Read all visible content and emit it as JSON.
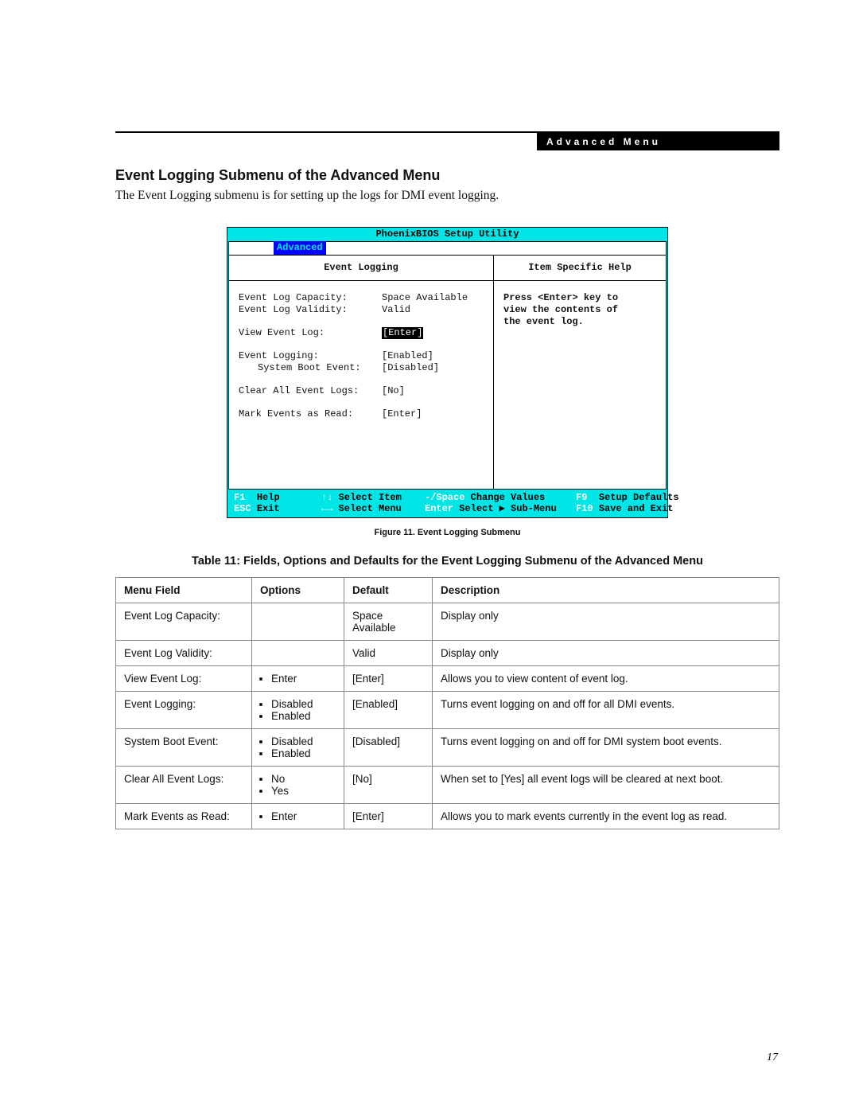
{
  "header": {
    "tab_label": "Advanced Menu"
  },
  "section": {
    "title": "Event Logging Submenu of the Advanced Menu",
    "intro": "The Event Logging submenu is for setting up the logs for DMI event logging."
  },
  "bios": {
    "utility_title": "PhoenixBIOS Setup Utility",
    "active_tab": "Advanced",
    "left_header": "Event Logging",
    "right_header": "Item Specific Help",
    "help_text_l1": "Press <Enter> key to",
    "help_text_l2": "view the contents of",
    "help_text_l3": "the event log.",
    "rows": {
      "capacity_label": "Event Log Capacity:",
      "capacity_value": "Space Available",
      "validity_label": "Event Log Validity:",
      "validity_value": "Valid",
      "view_label": "View Event Log:",
      "view_value": "[Enter]",
      "logging_label": "Event Logging:",
      "logging_value": "[Enabled]",
      "sysboot_label": "System Boot Event:",
      "sysboot_value": "[Disabled]",
      "clear_label": "Clear All Event Logs:",
      "clear_value": "[No]",
      "mark_label": "Mark Events as Read:",
      "mark_value": "[Enter]"
    },
    "footer": {
      "f1_key": "F1",
      "f1_label": "Help",
      "up_key": "↑↓",
      "up_label": "Select Item",
      "pm_key": "-/Space",
      "pm_label": "Change Values",
      "f9_key": "F9",
      "f9_label": "Setup Defaults",
      "esc_key": "ESC",
      "esc_label": "Exit",
      "lr_key": "←→",
      "lr_label": "Select Menu",
      "ent_key": "Enter",
      "ent_label": "Select ▶ Sub-Menu",
      "f10_key": "F10",
      "f10_label": "Save and Exit"
    }
  },
  "figure_caption": "Figure 11.  Event Logging Submenu",
  "table_title": "Table 11: Fields, Options and Defaults for the Event Logging Submenu of the Advanced Menu",
  "table": {
    "headers": {
      "menu_field": "Menu Field",
      "options": "Options",
      "default": "Default",
      "description": "Description"
    },
    "rows": [
      {
        "menu_field": "Event Log Capacity:",
        "options": [],
        "default": "Space Available",
        "description": "Display only"
      },
      {
        "menu_field": "Event Log Validity:",
        "options": [],
        "default": "Valid",
        "description": "Display only"
      },
      {
        "menu_field": "View Event Log:",
        "options": [
          "Enter"
        ],
        "default": "[Enter]",
        "description": "Allows you to view content of event log."
      },
      {
        "menu_field": "Event Logging:",
        "options": [
          "Disabled",
          "Enabled"
        ],
        "default": "[Enabled]",
        "description": "Turns event logging on and off for all DMI events."
      },
      {
        "menu_field": "System Boot Event:",
        "options": [
          "Disabled",
          "Enabled"
        ],
        "default": "[Disabled]",
        "description": "Turns event logging on and off for DMI system boot events."
      },
      {
        "menu_field": "Clear All Event Logs:",
        "options": [
          "No",
          "Yes"
        ],
        "default": "[No]",
        "description": "When set to [Yes] all event logs will be cleared at next boot."
      },
      {
        "menu_field": "Mark Events as Read:",
        "options": [
          "Enter"
        ],
        "default": "[Enter]",
        "description": "Allows you to mark events currently in the event log as read."
      }
    ]
  },
  "page_number": "17"
}
